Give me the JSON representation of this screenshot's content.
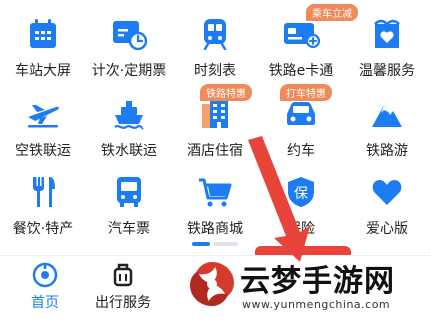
{
  "colors": {
    "accent": "#1d7cf2",
    "badge": "#f08a5a",
    "red": "#e8443a",
    "text": "#222222"
  },
  "services": [
    {
      "label": "车站大屏",
      "icon": "calendar-screen-icon",
      "badge": ""
    },
    {
      "label": "计次·定期票",
      "icon": "ticket-clock-icon",
      "badge": ""
    },
    {
      "label": "时刻表",
      "icon": "train-icon",
      "badge": ""
    },
    {
      "label": "铁路e卡通",
      "icon": "card-icon",
      "badge": "乘车立减"
    },
    {
      "label": "温馨服务",
      "icon": "heart-gift-icon",
      "badge": ""
    },
    {
      "label": "空铁联运",
      "icon": "plane-icon",
      "badge": ""
    },
    {
      "label": "铁水联运",
      "icon": "ship-icon",
      "badge": ""
    },
    {
      "label": "酒店住宿",
      "icon": "hotel-icon",
      "badge": "铁路特惠"
    },
    {
      "label": "约车",
      "icon": "car-icon",
      "badge": "打车特惠"
    },
    {
      "label": "铁路游",
      "icon": "mountain-icon",
      "badge": ""
    },
    {
      "label": "餐饮·特产",
      "icon": "fork-knife-icon",
      "badge": ""
    },
    {
      "label": "汽车票",
      "icon": "bus-icon",
      "badge": ""
    },
    {
      "label": "铁路商城",
      "icon": "cart-icon",
      "badge": ""
    },
    {
      "label": "保险",
      "icon": "shield-icon",
      "badge": ""
    },
    {
      "label": "爱心版",
      "icon": "heart-icon",
      "badge": ""
    }
  ],
  "shield_text": "保",
  "nav": {
    "home": "首页",
    "trip": "出行服务"
  },
  "watermark": {
    "title": "云梦手游网",
    "url": "www.yunmengchina.com"
  }
}
